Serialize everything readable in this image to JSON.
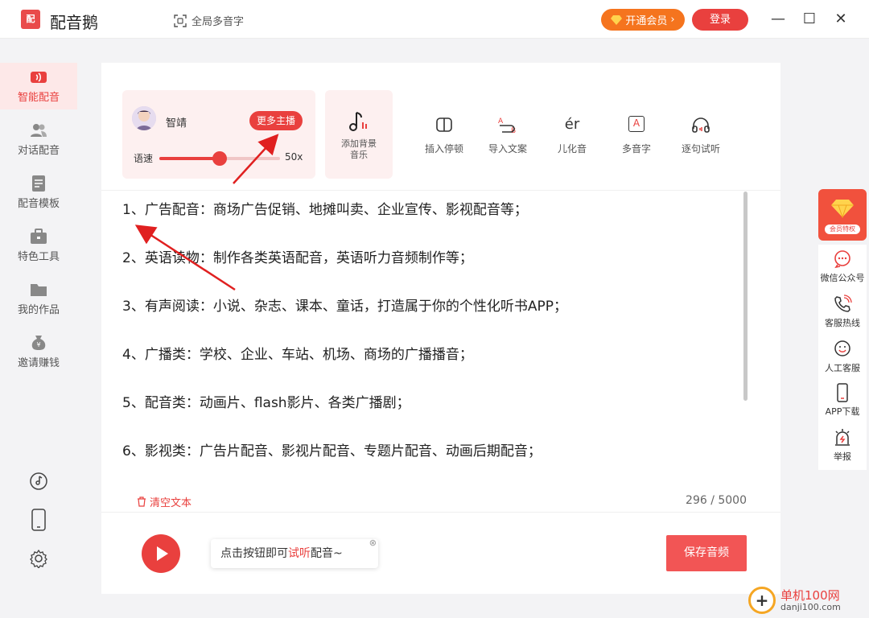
{
  "app": {
    "logo_text": "配",
    "title": "配音鹅"
  },
  "header": {
    "global_multi": "全局多音字",
    "vip_label": "开通会员",
    "login_label": "登录",
    "minimize": "—",
    "maximize": "☐",
    "close": "✕"
  },
  "sidebar": {
    "items": [
      {
        "label": "智能配音",
        "icon": "smart-dubbing-icon",
        "active": true
      },
      {
        "label": "对话配音",
        "icon": "users-icon"
      },
      {
        "label": "配音模板",
        "icon": "template-icon"
      },
      {
        "label": "特色工具",
        "icon": "toolbox-icon"
      },
      {
        "label": "我的作品",
        "icon": "folder-icon"
      },
      {
        "label": "邀请赚钱",
        "icon": "money-bag-icon"
      }
    ],
    "bottom_icons": [
      "music-link-icon",
      "phone-icon",
      "settings-icon"
    ]
  },
  "voice": {
    "name": "智靖",
    "more_label": "更多主播",
    "speed_label": "语速",
    "speed_value": "50x",
    "speed_fraction": 0.5
  },
  "bgm": {
    "label": "添加背景音乐"
  },
  "tools": [
    {
      "label": "插入停顿",
      "icon": "pause-icon"
    },
    {
      "label": "导入文案",
      "icon": "import-text-icon"
    },
    {
      "label": "儿化音",
      "icon": "erhua-icon"
    },
    {
      "label": "多音字",
      "icon": "polyphone-icon"
    },
    {
      "label": "逐句试听",
      "icon": "headphones-icon"
    }
  ],
  "tool_glyphs": {
    "erhua": "ér",
    "polyphone": "A"
  },
  "editor": {
    "lines": [
      "1、广告配音：商场广告促销、地摊叫卖、企业宣传、影视配音等；",
      "2、英语读物：制作各类英语配音，英语听力音频制作等；",
      "3、有声阅读：小说、杂志、课本、童话，打造属于你的个性化听书APP；",
      "4、广播类：学校、企业、车站、机场、商场的广播播音；",
      "5、配音类：动画片、flash影片、各类广播剧；",
      "6、影视类：广告片配音、影视片配音、专题片配音、动画后期配音；"
    ],
    "clear_label": "清空文本",
    "counter": "296 / 5000"
  },
  "footer": {
    "tip_prefix": "点击按钮即可",
    "tip_highlight": "试听",
    "tip_suffix": "配音~",
    "tip_close": "⊗",
    "save_label": "保存音频"
  },
  "right_panel": {
    "member_label": "会员特权",
    "items": [
      {
        "label": "微信公众号",
        "icon": "chat-bubble-icon"
      },
      {
        "label": "客服热线",
        "icon": "phone-call-icon"
      },
      {
        "label": "人工客服",
        "icon": "smile-chat-icon"
      },
      {
        "label": "APP下载",
        "icon": "mobile-icon"
      },
      {
        "label": "举报",
        "icon": "alert-icon"
      }
    ]
  },
  "watermark": {
    "symbol": "+",
    "title": "单机100网",
    "url": "danji100.com"
  },
  "colors": {
    "accent": "#e9403e",
    "vip": "#f5741e",
    "sidebar_active_bg": "#fde8e8"
  }
}
